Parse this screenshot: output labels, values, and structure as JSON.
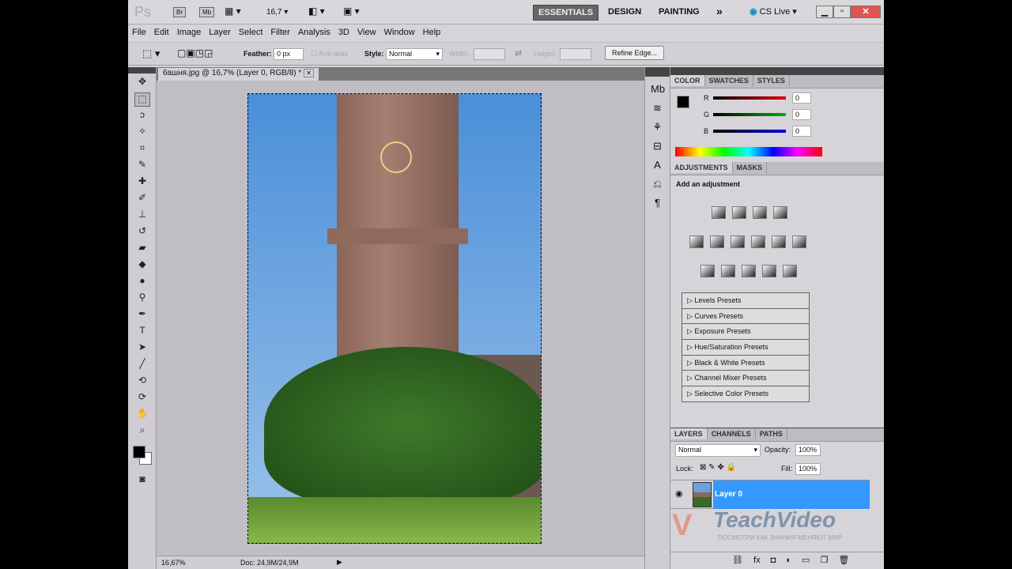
{
  "appbar": {
    "logo": "Ps",
    "bridge": "Br",
    "minibridge": "Mb",
    "zoom": "16,7",
    "workspaces": [
      "ESSENTIALS",
      "DESIGN",
      "PAINTING"
    ],
    "more": "»",
    "cslive": "CS Live"
  },
  "menu": [
    "File",
    "Edit",
    "Image",
    "Layer",
    "Select",
    "Filter",
    "Analysis",
    "3D",
    "View",
    "Window",
    "Help"
  ],
  "options": {
    "feather_label": "Feather:",
    "feather_value": "0 px",
    "antialias": "Anti-alias",
    "style_label": "Style:",
    "style_value": "Normal",
    "width_label": "Width:",
    "height_label": "Height:",
    "refine": "Refine Edge..."
  },
  "document": {
    "tab": "6ашня.jpg @ 16,7% (Layer 0, RGB/8) *",
    "zoom": "16,67%",
    "doc_info": "Doc: 24,9M/24,9M"
  },
  "color_panel": {
    "tabs": [
      "COLOR",
      "SWATCHES",
      "STYLES"
    ],
    "channels": [
      {
        "label": "R",
        "value": "0",
        "color": "#e00000"
      },
      {
        "label": "G",
        "value": "0",
        "color": "#00b000"
      },
      {
        "label": "B",
        "value": "0",
        "color": "#0000e0"
      }
    ]
  },
  "adjustments": {
    "tabs": [
      "ADJUSTMENTS",
      "MASKS"
    ],
    "heading": "Add an adjustment",
    "presets": [
      "Levels Presets",
      "Curves Presets",
      "Exposure Presets",
      "Hue/Saturation Presets",
      "Black & White Presets",
      "Channel Mixer Presets",
      "Selective Color Presets"
    ]
  },
  "layers": {
    "tabs": [
      "LAYERS",
      "CHANNELS",
      "PATHS"
    ],
    "blend": "Normal",
    "opacity_label": "Opacity:",
    "opacity": "100%",
    "lock_label": "Lock:",
    "fill_label": "Fill:",
    "fill": "100%",
    "items": [
      {
        "name": "Layer 0",
        "selected": true
      }
    ],
    "selected_color": "#3399ff"
  },
  "watermark": {
    "brand": "TeachVideo",
    "slogan": "ПОСМОТРИ КАК ЗНАНИЯ МЕНЯЮТ МИР"
  }
}
